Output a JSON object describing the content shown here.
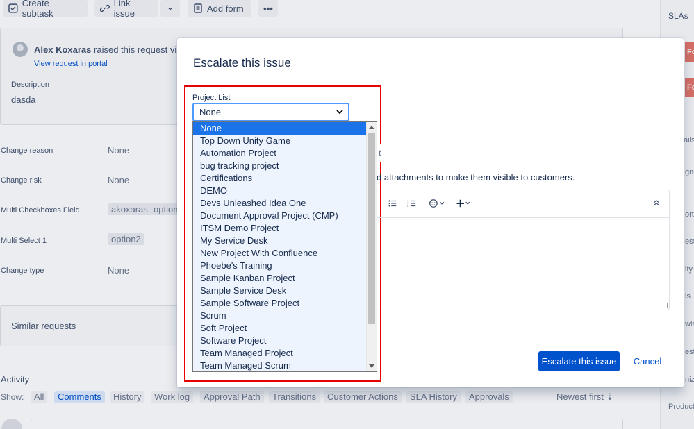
{
  "toolbar": {
    "create_subtask": "Create subtask",
    "link_issue": "Link issue",
    "add_form": "Add form"
  },
  "request": {
    "author": "Alex Koxaras",
    "raised_text": "raised this request via P",
    "view_portal": "View request in portal",
    "description_label": "Description",
    "description_value": "dasda"
  },
  "fields": [
    {
      "label": "Change reason",
      "value": "None"
    },
    {
      "label": "Change risk",
      "value": "None"
    },
    {
      "label": "Multi Checkboxes Field",
      "chips": [
        "akoxaras",
        "option"
      ]
    },
    {
      "label": "Multi Select 1",
      "chips": [
        "option2"
      ]
    },
    {
      "label": "Change type",
      "value": "None"
    }
  ],
  "similar": {
    "title": "Similar requests"
  },
  "activity": {
    "title": "Activity",
    "show_label": "Show:",
    "tabs": [
      "All",
      "Comments",
      "History",
      "Work log",
      "Approval Path",
      "Transitions",
      "Customer Actions",
      "SLA History",
      "Approvals"
    ],
    "active_tab": "Comments",
    "sort": "Newest first"
  },
  "sidebar": {
    "slas": "SLAs",
    "badge1": "Fo",
    "badge2": "Fo",
    "fragments": [
      "ails",
      "gne",
      "orte",
      "est",
      "ity",
      "ls",
      "wle",
      "est",
      "niz",
      "Product"
    ]
  },
  "modal": {
    "title": "Escalate this issue",
    "project_list_label": "Project List",
    "selected": "None",
    "options": [
      "None",
      "Top Down Unity Game",
      "Automation Project",
      "bug tracking project",
      "Certifications",
      "DEMO",
      "Devs Unleashed Idea One",
      "Document Approval Project (CMP)",
      "ITSM Demo Project",
      "My Service Desk",
      "New Project With Confluence",
      "Phoebe's Training",
      "Sample Kanban Project",
      "Sample Service Desk",
      "Sample Software Project",
      "Scrum",
      "Soft Project",
      "Software Project",
      "Team Managed Project",
      "Team Managed Scrum"
    ],
    "tab_fragment": "t",
    "info_text": "d attachments to make them visible to customers.",
    "submit": "Escalate this issue",
    "cancel": "Cancel"
  },
  "colors": {
    "primary": "#0052cc",
    "highlight": "#1a73e8",
    "annotation": "#e60000",
    "sla_badge": "#e5776b"
  }
}
